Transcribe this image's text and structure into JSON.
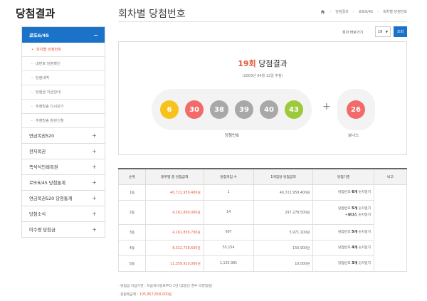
{
  "sidebar": {
    "title": "당첨결과",
    "active": {
      "label": "로또6/45",
      "sign": "−"
    },
    "subitems": [
      {
        "label": "회차별 당첨번호"
      },
      {
        "label": "내번호 당첨확인"
      },
      {
        "label": "당첨내역"
      },
      {
        "label": "당첨금 지급안내"
      },
      {
        "label": "추첨방송 다시보기"
      },
      {
        "label": "추첨방송 참관신청"
      }
    ],
    "items": [
      {
        "label": "연금복권520",
        "sign": "+"
      },
      {
        "label": "전자복권",
        "sign": "+"
      },
      {
        "label": "즉석식인쇄복권",
        "sign": "+"
      },
      {
        "label": "로또6/45 당첨통계",
        "sign": "+"
      },
      {
        "label": "연금복권520 당첨통계",
        "sign": "+"
      },
      {
        "label": "당첨소식",
        "sign": "+"
      },
      {
        "label": "미수령 당첨금",
        "sign": "+"
      }
    ]
  },
  "header": {
    "title": "회차별 당첨번호",
    "breadcrumb": [
      "당첨결과",
      "로또6/45",
      "회차별 당첨번호"
    ]
  },
  "round_move": {
    "label": "회차 바로가기",
    "selected": "19",
    "button": "조회"
  },
  "result": {
    "round": "19회",
    "title_suffix": "당첨결과",
    "date": "(2003년 04월 12일 추첨)",
    "numbers": [
      {
        "value": "6",
        "color": "#f7c21b"
      },
      {
        "value": "30",
        "color": "#f26a6a"
      },
      {
        "value": "38",
        "color": "#a8a8a8"
      },
      {
        "value": "39",
        "color": "#a8a8a8"
      },
      {
        "value": "40",
        "color": "#a8a8a8"
      },
      {
        "value": "43",
        "color": "#9dca3c"
      }
    ],
    "plus": "+",
    "bonus": {
      "value": "26",
      "color": "#f26a6a"
    },
    "win_label": "당첨번호",
    "bonus_label": "보너스"
  },
  "table": {
    "headers": [
      "순위",
      "등위별 총 당첨금액",
      "당첨게임 수",
      "1게임당 당첨금액",
      "당첨기준",
      "비고"
    ],
    "rows": [
      {
        "rank": "1등",
        "total": "40,722,959,400원",
        "games": "1",
        "per_game": "40,722,959,400원",
        "criteria": [
          {
            "pre": "당첨번호 ",
            "bold": "6개",
            "post": " 숫자일치"
          }
        ]
      },
      {
        "rank": "2등",
        "total": "4,161,899,000원",
        "games": "14",
        "per_game": "297,278,500원",
        "criteria": [
          {
            "pre": "당첨번호 ",
            "bold": "5개",
            "post": " 숫자일치"
          },
          {
            "pre": "+",
            "bold": "보너스",
            "post": " 숫자일치"
          }
        ]
      },
      {
        "rank": "3등",
        "total": "4,161,856,700원",
        "games": "697",
        "per_game": "5,971,100원",
        "criteria": [
          {
            "pre": "당첨번호 ",
            "bold": "5개",
            "post": " 숫자일치"
          }
        ]
      },
      {
        "rank": "4등",
        "total": "8,322,738,600원",
        "games": "55,154",
        "per_game": "150,900원",
        "criteria": [
          {
            "pre": "당첨번호 ",
            "bold": "4개",
            "post": " 숫자일치"
          }
        ]
      },
      {
        "rank": "5등",
        "total": "11,359,910,000원",
        "games": "1,135,991",
        "per_game": "10,000원",
        "criteria": [
          {
            "pre": "당첨번호 ",
            "bold": "3개",
            "post": " 숫자일치"
          }
        ]
      }
    ]
  },
  "notes": {
    "line1": "당첨금 지급기한 : 지급개시일로부터 1년 (휴일인 경우 익영업일)",
    "line2_label": "총판매금액 : ",
    "line2_value": "105,957,818,000원"
  }
}
